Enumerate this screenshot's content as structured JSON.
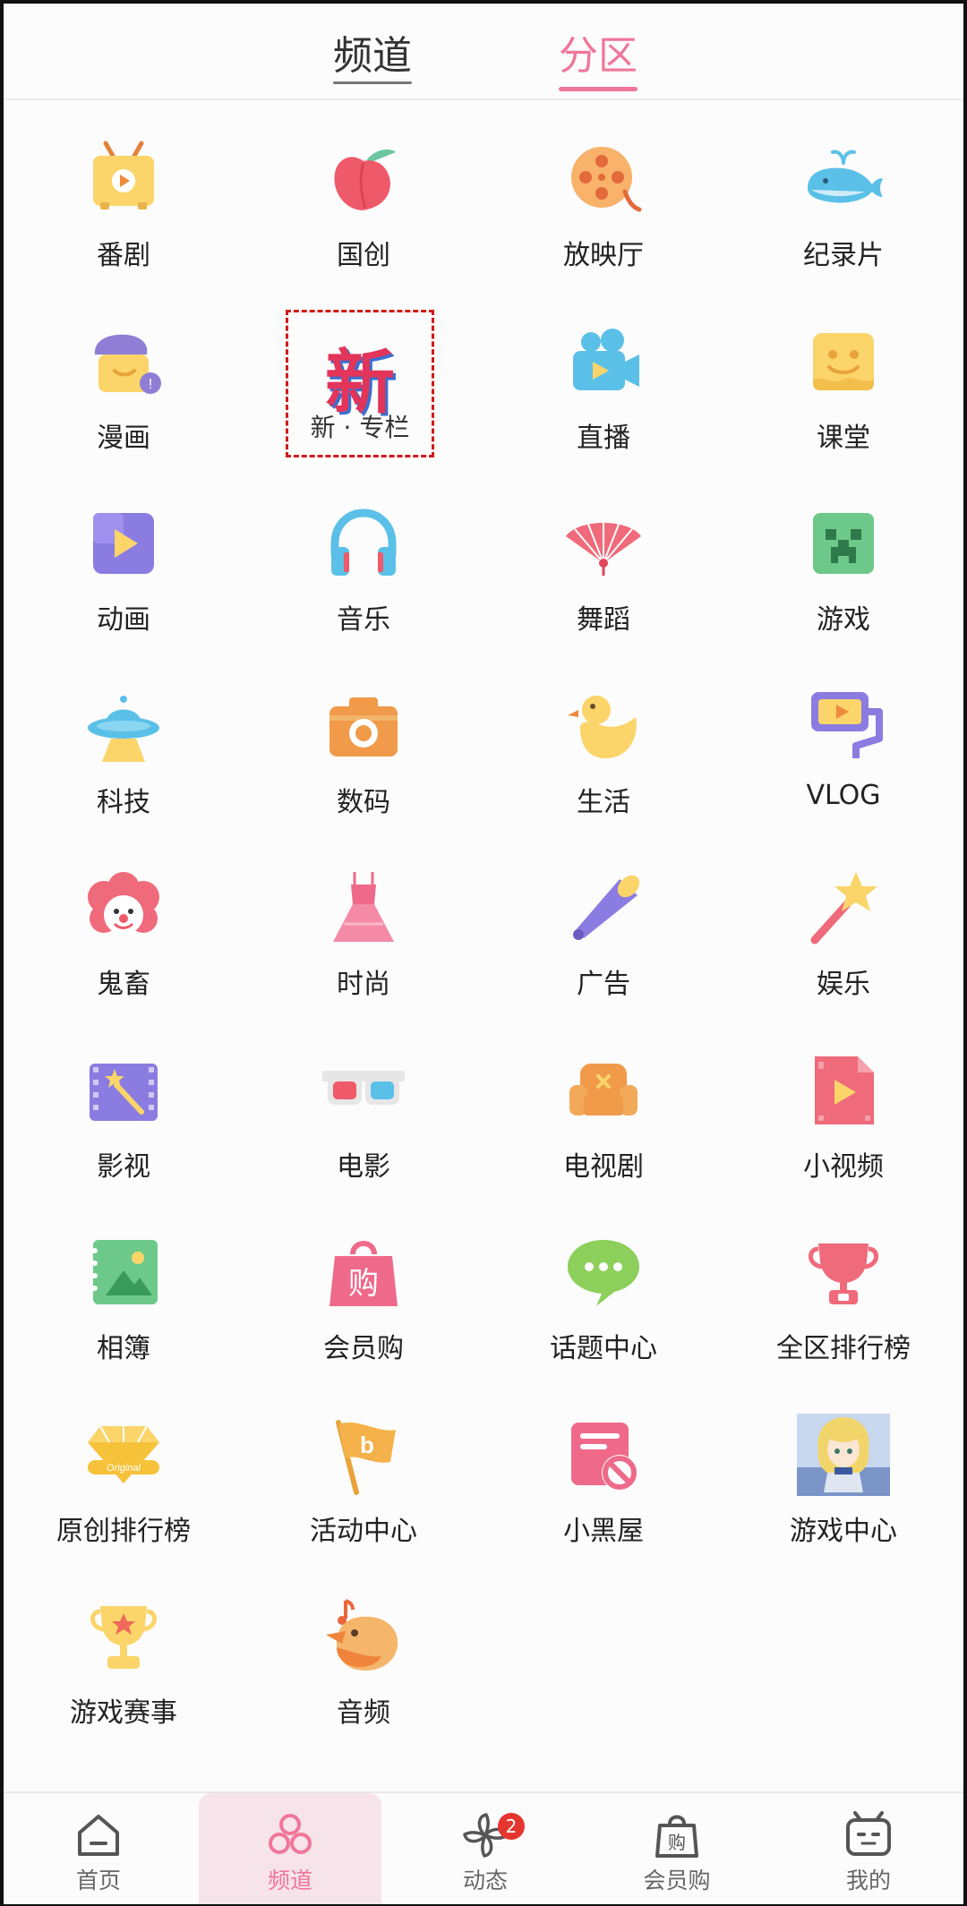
{
  "top_tabs": [
    {
      "label": "频道",
      "active": false
    },
    {
      "label": "分区",
      "active": true
    }
  ],
  "accent_color": "#f0769a",
  "grid_items": [
    {
      "label": "番剧",
      "icon": "tv-icon"
    },
    {
      "label": "国创",
      "icon": "peach-icon"
    },
    {
      "label": "放映厅",
      "icon": "film-reel-icon"
    },
    {
      "label": "纪录片",
      "icon": "whale-icon"
    },
    {
      "label": "漫画",
      "icon": "painter-hat-icon"
    },
    {
      "label": "新 · 专栏",
      "icon": "new-badge-icon",
      "badge_text": "新"
    },
    {
      "label": "直播",
      "icon": "video-camera-icon"
    },
    {
      "label": "课堂",
      "icon": "cheese-icon"
    },
    {
      "label": "动画",
      "icon": "play-puzzle-icon"
    },
    {
      "label": "音乐",
      "icon": "headphones-icon"
    },
    {
      "label": "舞蹈",
      "icon": "fan-icon"
    },
    {
      "label": "游戏",
      "icon": "creeper-icon"
    },
    {
      "label": "科技",
      "icon": "ufo-icon"
    },
    {
      "label": "数码",
      "icon": "camera-icon"
    },
    {
      "label": "生活",
      "icon": "duck-icon"
    },
    {
      "label": "VLOG",
      "icon": "vlog-camera-icon"
    },
    {
      "label": "鬼畜",
      "icon": "clown-icon"
    },
    {
      "label": "时尚",
      "icon": "dress-icon"
    },
    {
      "label": "广告",
      "icon": "megaphone-icon"
    },
    {
      "label": "娱乐",
      "icon": "star-wand-icon"
    },
    {
      "label": "影视",
      "icon": "clapper-icon"
    },
    {
      "label": "电影",
      "icon": "3d-glasses-icon"
    },
    {
      "label": "电视剧",
      "icon": "sofa-icon"
    },
    {
      "label": "小视频",
      "icon": "video-file-icon"
    },
    {
      "label": "相簿",
      "icon": "photo-album-icon"
    },
    {
      "label": "会员购",
      "icon": "shopping-bag-icon"
    },
    {
      "label": "话题中心",
      "icon": "chat-bubble-icon"
    },
    {
      "label": "全区排行榜",
      "icon": "trophy-cup-icon"
    },
    {
      "label": "原创排行榜",
      "icon": "diamond-original-icon"
    },
    {
      "label": "活动中心",
      "icon": "flag-icon"
    },
    {
      "label": "小黑屋",
      "icon": "ban-card-icon"
    },
    {
      "label": "游戏中心",
      "icon": "game-avatar-icon"
    },
    {
      "label": "游戏赛事",
      "icon": "trophy-star-icon"
    },
    {
      "label": "音频",
      "icon": "bird-note-icon"
    }
  ],
  "bottom_nav": [
    {
      "label": "首页",
      "icon": "home-icon",
      "active": false
    },
    {
      "label": "频道",
      "icon": "circles-icon",
      "active": true
    },
    {
      "label": "动态",
      "icon": "pinwheel-icon",
      "active": false,
      "badge": "2"
    },
    {
      "label": "会员购",
      "icon": "bag-icon",
      "active": false
    },
    {
      "label": "我的",
      "icon": "tv-face-icon",
      "active": false
    }
  ]
}
